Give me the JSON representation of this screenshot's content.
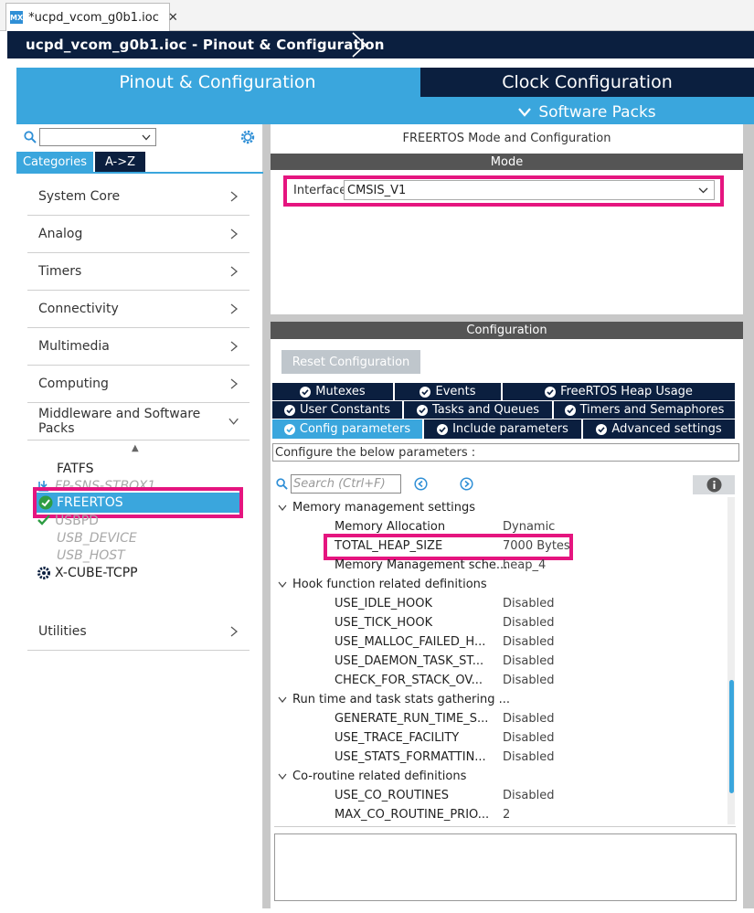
{
  "editor_tab": {
    "icon_text": "MX",
    "title": "*ucpd_vcom_g0b1.ioc"
  },
  "title_bar": {
    "title": "ucpd_vcom_g0b1.ioc - Pinout & Configuration"
  },
  "main_tabs": {
    "pinout": "Pinout & Configuration",
    "clock": "Clock Configuration",
    "software_packs": "Software Packs"
  },
  "left_panel": {
    "segments": {
      "categories": "Categories",
      "az": "A->Z"
    },
    "categories": [
      {
        "label": "System Core"
      },
      {
        "label": "Analog"
      },
      {
        "label": "Timers"
      },
      {
        "label": "Connectivity"
      },
      {
        "label": "Multimedia"
      },
      {
        "label": "Computing"
      },
      {
        "label": "Middleware and Software Packs"
      }
    ],
    "middleware_items": [
      {
        "label": "FATFS"
      },
      {
        "label": "FP-SNS-STBOX1"
      },
      {
        "label": "FREERTOS"
      },
      {
        "label": "USBPD"
      },
      {
        "label": "USB_DEVICE"
      },
      {
        "label": "USB_HOST"
      },
      {
        "label": "X-CUBE-TCPP"
      }
    ],
    "utilities": "Utilities"
  },
  "mode_panel": {
    "heading": "FREERTOS Mode and Configuration",
    "mode_bar": "Mode",
    "interface_label": "Interface",
    "interface_value": "CMSIS_V1"
  },
  "config_panel": {
    "bar": "Configuration",
    "reset_button": "Reset Configuration",
    "tabs_row1": [
      "Mutexes",
      "Events",
      "FreeRTOS Heap Usage"
    ],
    "tabs_row2": [
      "User Constants",
      "Tasks and Queues",
      "Timers and Semaphores"
    ],
    "tabs_row3": [
      "Config parameters",
      "Include parameters",
      "Advanced settings"
    ],
    "configure_text": "Configure the below parameters :",
    "search_placeholder": "Search (Ctrl+F)",
    "groups": [
      {
        "label": "Memory management settings"
      },
      {
        "label": "Hook function related definitions"
      },
      {
        "label": "Run time and task stats gathering ..."
      },
      {
        "label": "Co-routine related definitions"
      }
    ],
    "params": [
      {
        "name": "Memory Allocation",
        "value": "Dynamic"
      },
      {
        "name": "TOTAL_HEAP_SIZE",
        "value": "7000 Bytes"
      },
      {
        "name": "Memory Management sche...",
        "value": "heap_4"
      },
      {
        "name": "USE_IDLE_HOOK",
        "value": "Disabled"
      },
      {
        "name": "USE_TICK_HOOK",
        "value": "Disabled"
      },
      {
        "name": "USE_MALLOC_FAILED_H...",
        "value": "Disabled"
      },
      {
        "name": "USE_DAEMON_TASK_ST...",
        "value": "Disabled"
      },
      {
        "name": "CHECK_FOR_STACK_OV...",
        "value": "Disabled"
      },
      {
        "name": "GENERATE_RUN_TIME_S...",
        "value": "Disabled"
      },
      {
        "name": "USE_TRACE_FACILITY",
        "value": "Disabled"
      },
      {
        "name": "USE_STATS_FORMATTIN...",
        "value": "Disabled"
      },
      {
        "name": "USE_CO_ROUTINES",
        "value": "Disabled"
      },
      {
        "name": "MAX_CO_ROUTINE_PRIO...",
        "value": "2"
      }
    ]
  },
  "colors": {
    "accent": "#3aa6dd",
    "navy": "#0b1f3f",
    "highlight": "#e5157f",
    "check_green": "#2e9d44"
  }
}
